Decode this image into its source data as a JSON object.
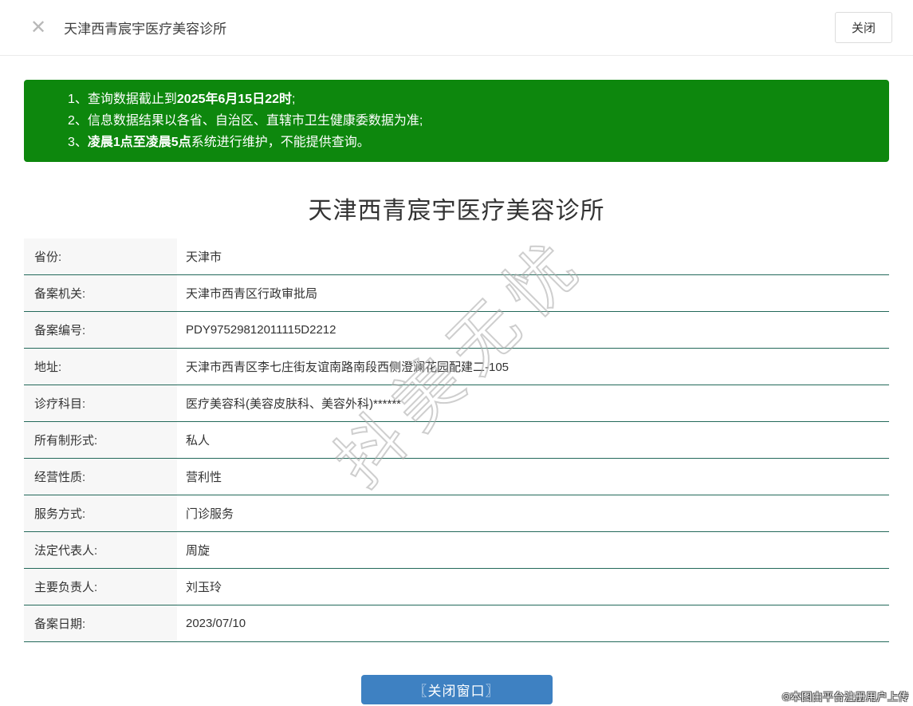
{
  "header": {
    "title": "天津西青宸宇医疗美容诊所",
    "close_icon_glyph": "✕",
    "close_button_label": "关闭"
  },
  "notice": {
    "items": [
      {
        "prefix": "1、",
        "pre": "查询数据截止到",
        "bold": "2025年6月15日22时",
        "post": ";"
      },
      {
        "prefix": "2、",
        "pre": "信息数据结果以各省、自治区、直辖市卫生健康委数据为准;",
        "bold": "",
        "post": ""
      },
      {
        "prefix": "3、",
        "pre": "",
        "bold": "凌晨1点至凌晨5点",
        "post": "系统进行维护，不能提供查询。"
      }
    ]
  },
  "main": {
    "title": "天津西青宸宇医疗美容诊所",
    "fields": [
      {
        "label": "省份:",
        "value": "天津市"
      },
      {
        "label": "备案机关:",
        "value": "天津市西青区行政审批局"
      },
      {
        "label": "备案编号:",
        "value": "PDY97529812011115D2212"
      },
      {
        "label": "地址:",
        "value": "天津市西青区李七庄街友谊南路南段西侧澄澜花园配建二-105"
      },
      {
        "label": "诊疗科目:",
        "value": "医疗美容科(美容皮肤科、美容外科)******"
      },
      {
        "label": "所有制形式:",
        "value": "私人"
      },
      {
        "label": "经营性质:",
        "value": "营利性"
      },
      {
        "label": "服务方式:",
        "value": "门诊服务"
      },
      {
        "label": "法定代表人:",
        "value": "周旋"
      },
      {
        "label": "主要负责人:",
        "value": "刘玉玲"
      },
      {
        "label": "备案日期:",
        "value": "2023/07/10"
      }
    ]
  },
  "footer": {
    "close_window_button_label": "〖关闭窗口〗",
    "copyright": "©本图由平台注册用户上传"
  },
  "watermark_text": "抖美无忧",
  "colors": {
    "notice_green": "#0d870d",
    "table_border_teal": "#23695a",
    "button_blue": "#3e81c2",
    "label_cell_bg": "#f7f7f7"
  }
}
